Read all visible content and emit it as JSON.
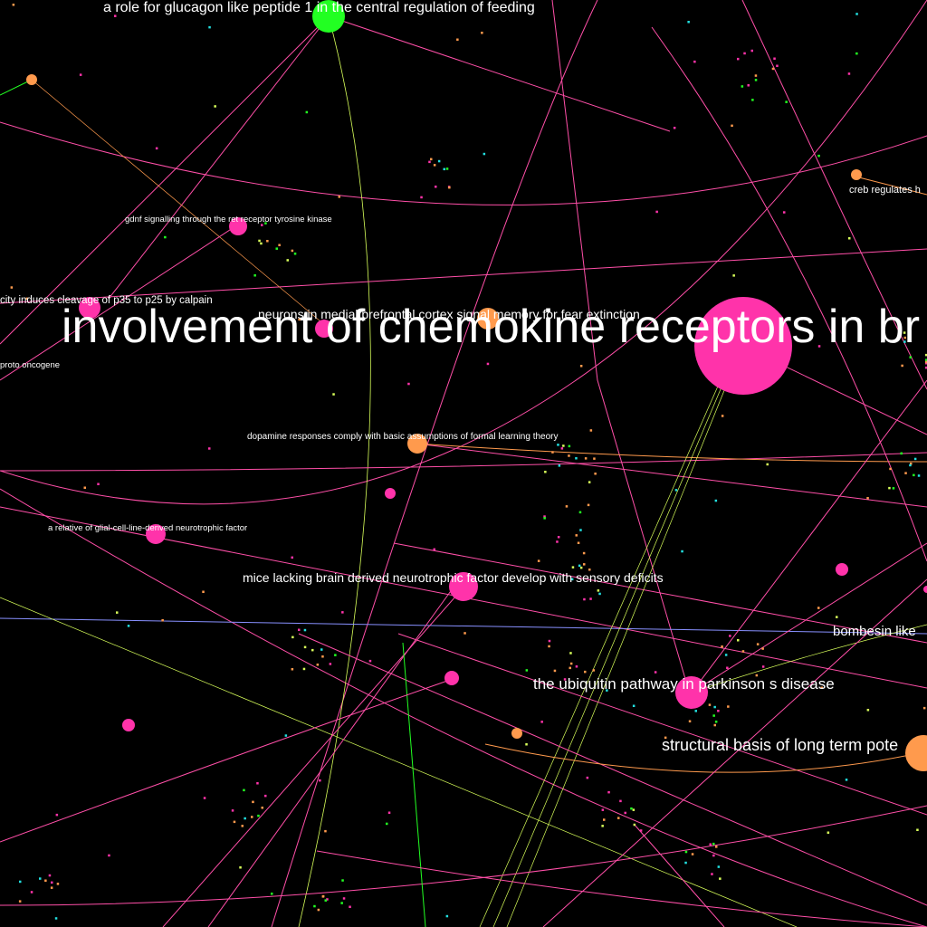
{
  "colors": {
    "background": "#000000",
    "magenta": "#ff33aa",
    "pink_line": "#ff4fa8",
    "orange": "#ff9a4d",
    "green": "#22ff22",
    "yellow_green": "#d8ff5a",
    "blue": "#8890ff",
    "cyan": "#22e0e0"
  },
  "nodes": [
    {
      "id": "glucagon",
      "label": "a role for glucagon like peptide 1 in the central regulation of feeding",
      "color": "#22ff22"
    },
    {
      "id": "chemokine",
      "label": "involvement of chemokine receptors in br",
      "color": "#ff33aa"
    },
    {
      "id": "creb",
      "label": "creb regulates h",
      "color": "#ff9a4d"
    },
    {
      "id": "gdnf",
      "label": "gdnf signalling through the ret receptor tyrosine kinase",
      "color": "#ff33aa"
    },
    {
      "id": "calpain",
      "label": "city induces cleavage of p35 to p25 by calpain",
      "color": "#ff33aa"
    },
    {
      "id": "prefrontal",
      "label": "neurons in medial prefrontal cortex signal memory for fear extinction",
      "color": "#ff9a4d"
    },
    {
      "id": "protooncogene",
      "label": "proto oncogene",
      "color": "#ff33aa"
    },
    {
      "id": "dopamine",
      "label": "dopamine responses comply with basic assumptions of formal learning theory",
      "color": "#ff9a4d"
    },
    {
      "id": "glial",
      "label": "a relative of glial-cell-line-derived neurotrophic factor",
      "color": "#ff33aa"
    },
    {
      "id": "bdnf",
      "label": "mice lacking brain derived neurotrophic factor develop with sensory deficits",
      "color": "#ff33aa"
    },
    {
      "id": "bombesin",
      "label": "bombesin like",
      "color": "#ff33aa"
    },
    {
      "id": "ubiquitin",
      "label": "the ubiquitin pathway in parkinson s disease",
      "color": "#ff33aa"
    },
    {
      "id": "ltp",
      "label": "structural basis of long term pote",
      "color": "#ff9a4d"
    }
  ]
}
